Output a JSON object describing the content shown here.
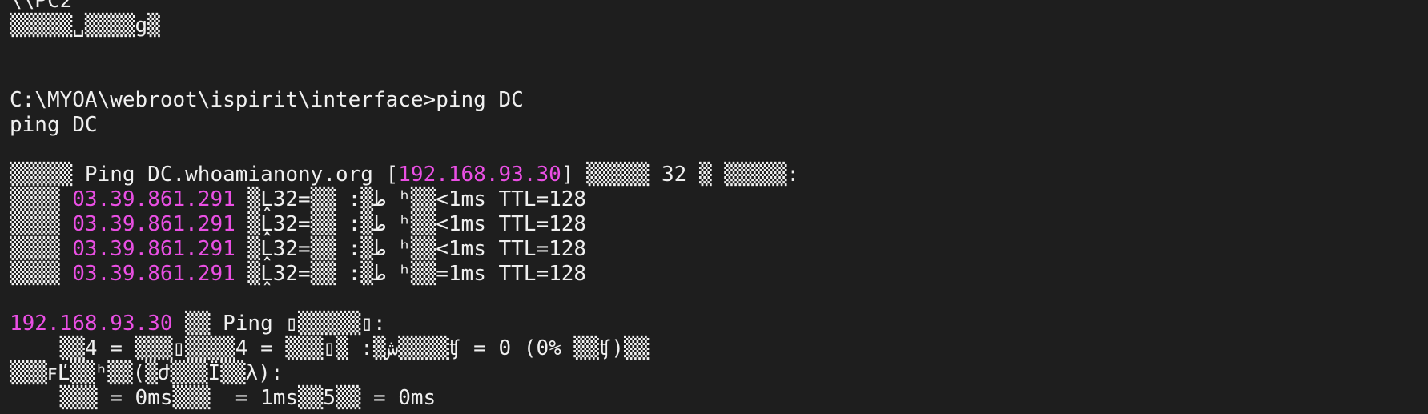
{
  "terminal": {
    "background": "#1e1e1e",
    "text_color": "#f0f0f0",
    "highlight_color": "#ea4fe4",
    "lines": [
      [
        {
          "t": "\\\\PC2"
        }
      ],
      [
        {
          "t": "▒▒▒▒▒␣▒▒▒▒g▒"
        }
      ],
      [
        {
          "t": ""
        }
      ],
      [
        {
          "t": ""
        }
      ],
      [
        {
          "t": "C:\\MYOA\\webroot\\ispirit\\interface>ping DC"
        }
      ],
      [
        {
          "t": "ping DC"
        }
      ],
      [
        {
          "t": ""
        }
      ],
      [
        {
          "t": "▒▒▒▒▒ Ping DC.whoamianony.org ["
        },
        {
          "t": "192.168.93.30",
          "hl": true
        },
        {
          "t": "] ▒▒▒▒▒ 32 ▒ ▒▒▒▒▒:"
        }
      ],
      [
        {
          "t": "▒▒▒▒ "
        },
        {
          "t": "03.39.861.291",
          "hl": true
        },
        {
          "t": " ▒Ḽ32=▒▒ :▒ط ʰ▒▒<1ms TTL=128"
        }
      ],
      [
        {
          "t": "▒▒▒▒ "
        },
        {
          "t": "03.39.861.291",
          "hl": true
        },
        {
          "t": " ▒Ḽ32=▒▒ :▒ط ʰ▒▒<1ms TTL=128"
        }
      ],
      [
        {
          "t": "▒▒▒▒ "
        },
        {
          "t": "03.39.861.291",
          "hl": true
        },
        {
          "t": " ▒Ḽ32=▒▒ :▒ط ʰ▒▒<1ms TTL=128"
        }
      ],
      [
        {
          "t": "▒▒▒▒ "
        },
        {
          "t": "03.39.861.291",
          "hl": true
        },
        {
          "t": " ▒Ḽ32=▒▒ :▒ط ʰ▒▒=1ms TTL=128"
        }
      ],
      [
        {
          "t": ""
        }
      ],
      [
        {
          "t": "192.168.93.30",
          "hl": true
        },
        {
          "t": " ▒▒ Ping ▯▒▒▒▒▒▯:"
        }
      ],
      [
        {
          "t": "    ▒▒ش▒: ▒▯▒▒▒ = 4▒▒▒▒▯▒▒▒ = 4▒▒▒▒ʧ = 0 (0% ▒▒ʧ)▒▒"
        }
      ],
      [
        {
          "t": "▒▒▒ꜰĽ▒▒ʰ▒▒(▒ժ▒▒▒Ï▒▒λ):"
        }
      ],
      [
        {
          "t": "    ▒▒▒ = 0ms▒▒▒  = 1ms▒▒5▒▒ = 0ms"
        }
      ]
    ]
  }
}
